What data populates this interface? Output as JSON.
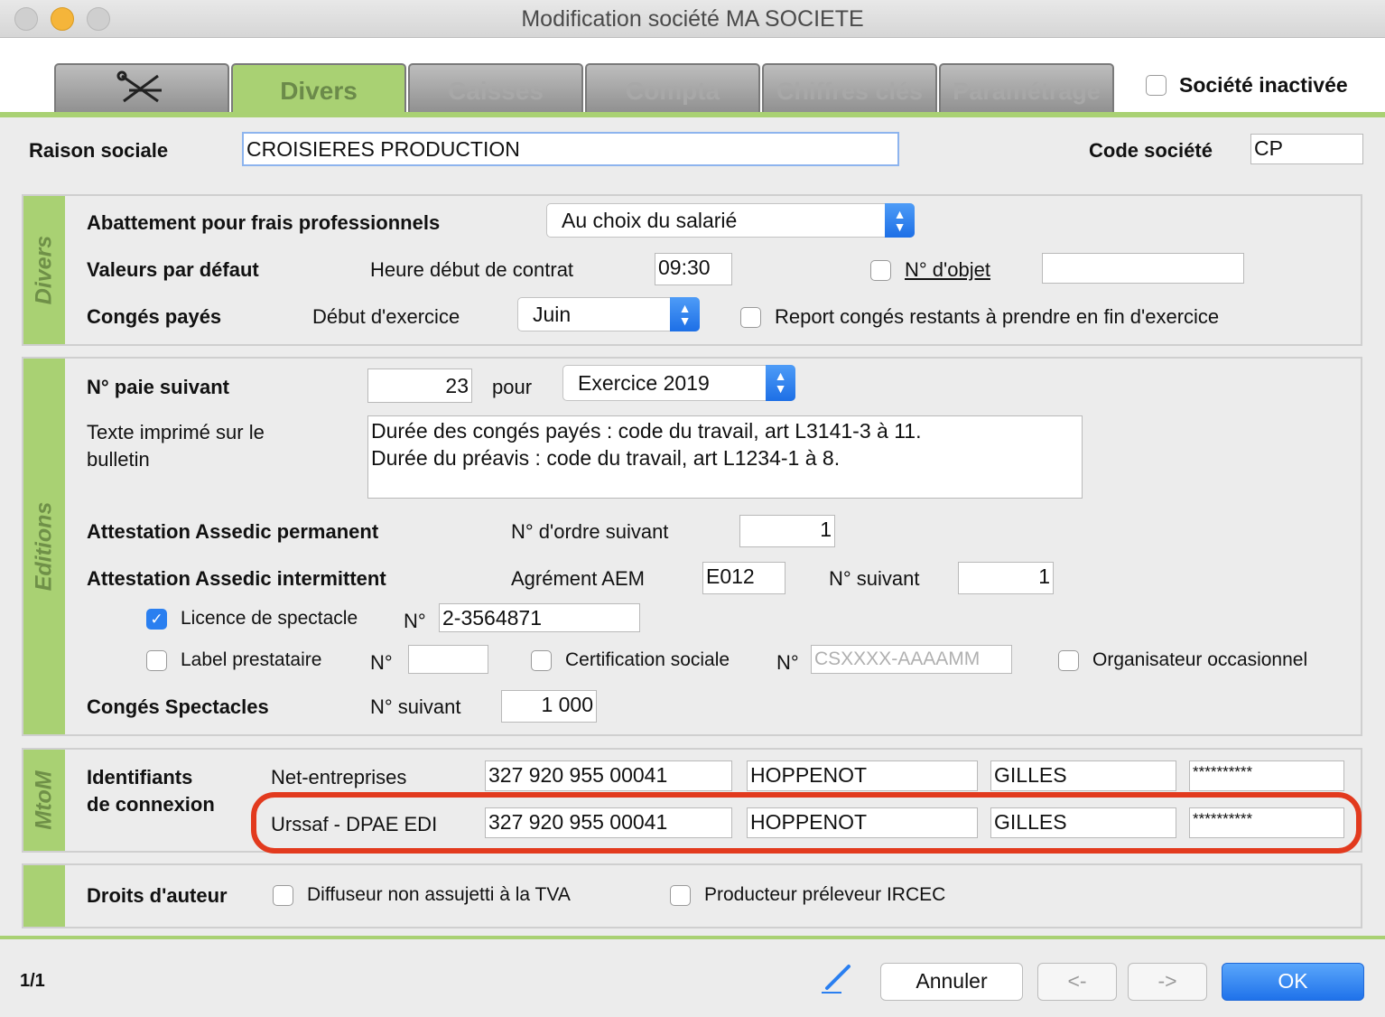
{
  "window": {
    "title": "Modification société MA SOCIETE"
  },
  "tabs": {
    "first_icon": "wrench-tools-icon",
    "divers": "Divers",
    "caisses": "Caisses",
    "compta": "Compta",
    "chiffres": "Chiffres clés",
    "parametrage": "Paramétrage"
  },
  "header": {
    "inactive_label": "Société inactivée",
    "raison_label": "Raison sociale",
    "raison_value": "CROISIERES PRODUCTION",
    "code_label": "Code société",
    "code_value": "CP"
  },
  "divers": {
    "side": "Divers",
    "abattement_label": "Abattement pour frais professionnels",
    "abattement_value": "Au choix du salarié",
    "valeurs_label": "Valeurs par défaut",
    "heure_label": "Heure début de contrat",
    "heure_value": "09:30",
    "objet_label": "N° d'objet",
    "objet_value": "",
    "conges_label": "Congés payés",
    "debut_label": "Début d'exercice",
    "debut_value": "Juin",
    "report_label": "Report congés restants à prendre en fin d'exercice"
  },
  "editions": {
    "side": "Editions",
    "paie_label": "N° paie suivant",
    "paie_value": "23",
    "pour_label": "pour",
    "exercice_value": "Exercice 2019",
    "texte_label_1": "Texte imprimé sur le",
    "texte_label_2": "bulletin",
    "texte_line_1": "Durée des congés payés : code du travail, art L3141-3 à 11.",
    "texte_line_2": "Durée du préavis : code du travail, art L1234-1 à 8.",
    "assedic_perm_label": "Attestation Assedic permanent",
    "ordre_label": "N° d'ordre suivant",
    "ordre_value": "1",
    "assedic_int_label": "Attestation Assedic intermittent",
    "agrement_label": "Agrément AEM",
    "agrement_value": "E012",
    "suivant_label": "N° suivant",
    "suivant_value": "1",
    "licence_label": "Licence de spectacle",
    "licence_checked": true,
    "no_label": "N°",
    "licence_value": "2-3564871",
    "label_presta": "Label prestataire",
    "label_presta_value": "",
    "certif_label": "Certification sociale",
    "certif_placeholder": "CSXXXX-AAAAMM",
    "organisateur_label": "Organisateur occasionnel",
    "conges_spect_label": "Congés Spectacles",
    "conges_spect_suivant": "N° suivant",
    "conges_spect_value": "1 000"
  },
  "mtom": {
    "side": "MtoM",
    "ident_label_1": "Identifiants",
    "ident_label_2": "de connexion",
    "rows": [
      {
        "label": "Net-entreprises",
        "siret": "327 920 955 00041",
        "nom": "HOPPENOT",
        "prenom": "GILLES",
        "password": "**********"
      },
      {
        "label": "Urssaf - DPAE EDI",
        "siret": "327 920 955 00041",
        "nom": "HOPPENOT",
        "prenom": "GILLES",
        "password": "**********"
      }
    ]
  },
  "droits": {
    "label": "Droits d'auteur",
    "diffuseur": "Diffuseur non assujetti à la TVA",
    "producteur": "Producteur préleveur IRCEC"
  },
  "footer": {
    "record": "1/1",
    "edit_icon": "pencil-icon",
    "cancel": "Annuler",
    "prev": "<-",
    "next": "->",
    "ok": "OK"
  },
  "colors": {
    "accent_green": "#a9d173",
    "highlight_red": "#e23a1e",
    "button_blue": "#1f72ea"
  }
}
